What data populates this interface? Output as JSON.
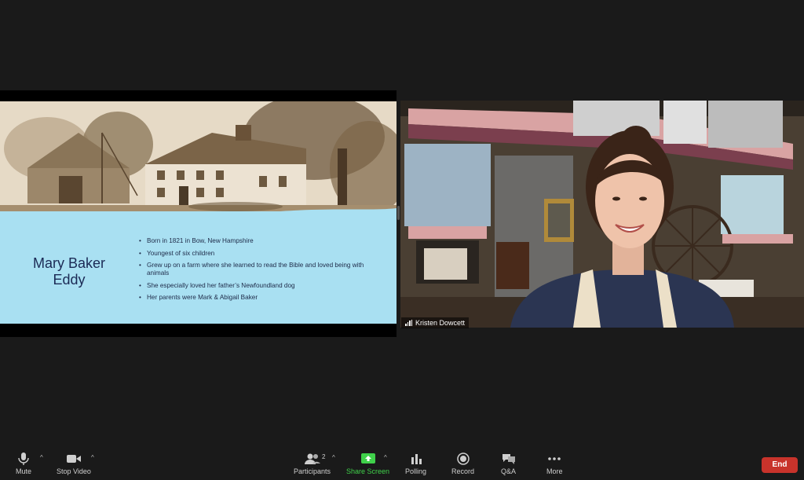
{
  "slide": {
    "title": "Mary Baker Eddy",
    "bullets": [
      "Born in 1821 in Bow, New Hampshire",
      "Youngest of six children",
      "Grew up on a farm where she learned to read the Bible and loved being with animals",
      "She especially loved her father’s Newfoundland dog",
      "Her parents were Mark & Abigail Baker"
    ]
  },
  "video": {
    "participant_name": "Kristen Dowcett"
  },
  "toolbar": {
    "mute_label": "Mute",
    "stop_video_label": "Stop Video",
    "participants_label": "Participants",
    "participants_count": "2",
    "share_screen_label": "Share Screen",
    "polling_label": "Polling",
    "record_label": "Record",
    "qa_label": "Q&A",
    "more_label": "More",
    "end_label": "End"
  },
  "colors": {
    "share_green": "#3fd14a",
    "end_red": "#c8332b",
    "slide_blue": "#a9e0f2"
  }
}
